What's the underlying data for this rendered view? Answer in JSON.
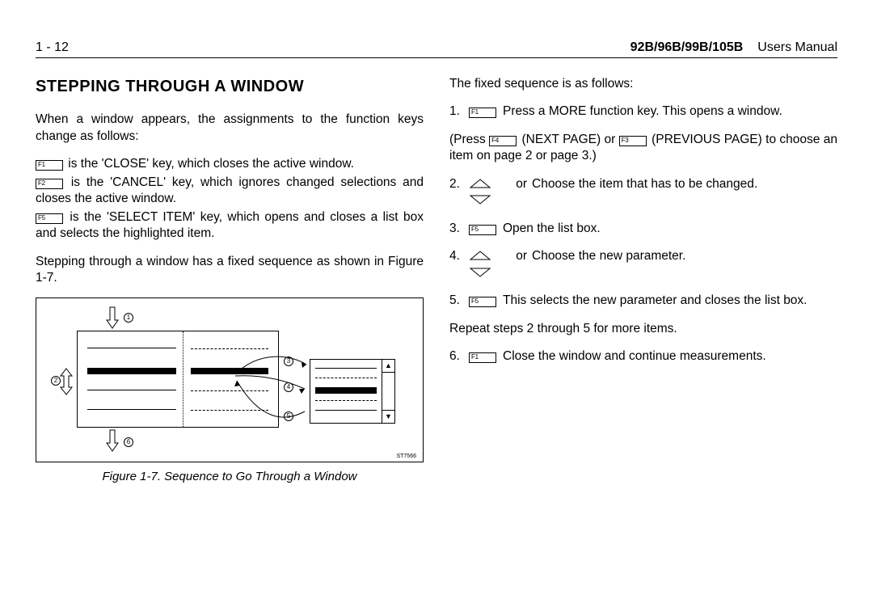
{
  "header": {
    "page_num": "1 - 12",
    "model": "92B/96B/99B/105B",
    "doc_type": "Users Manual"
  },
  "left": {
    "title": "STEPPING THROUGH A WINDOW",
    "intro": "When a window appears, the assignments to the function keys change as follows:",
    "f1_desc": " is the 'CLOSE' key, which closes the active window.",
    "f2_desc": " is the 'CANCEL' key, which ignores changed selections and closes the active window.",
    "f5_desc": " is the 'SELECT ITEM' key, which opens and closes a list box and selects the highlighted item.",
    "seq_intro": "Stepping through a window has a fixed sequence as shown in Figure 1-7.",
    "fig_label": "ST7566",
    "fig_caption": "Figure 1-7.   Sequence to Go Through a Window"
  },
  "right": {
    "intro": "The fixed sequence is as follows:",
    "step1": "Press a MORE function key. This opens a window.",
    "press_line_a": "(Press ",
    "press_line_b": " (NEXT PAGE) or ",
    "press_line_c": " (PREVIOUS PAGE) to choose an item on page 2 or page 3.)",
    "step2": "Choose the item that has to be changed.",
    "step3": "Open the list box.",
    "step4": "Choose the new parameter.",
    "step5": "This selects the new parameter and closes the list box.",
    "repeat": "Repeat steps 2 through 5 for more items.",
    "step6": "Close the window and continue measurements.",
    "or": " or "
  },
  "keys": {
    "f1": "F1",
    "f2": "F2",
    "f3": "F3",
    "f4": "F4",
    "f5": "F5"
  },
  "nums": {
    "n1": "1.",
    "n2": "2.",
    "n3": "3.",
    "n4": "4.",
    "n5": "5.",
    "n6": "6."
  }
}
